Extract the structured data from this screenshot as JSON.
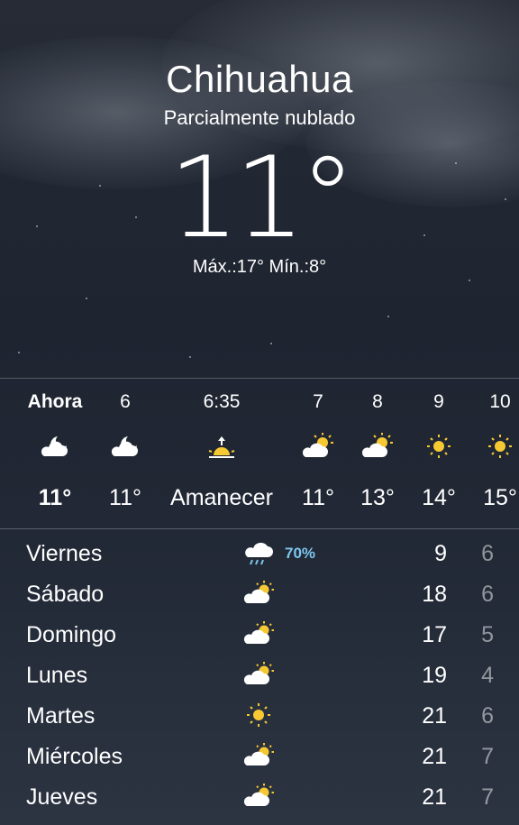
{
  "location": {
    "city": "Chihuahua",
    "condition": "Parcialmente nublado",
    "temperature": "11°",
    "hi_lo": "Máx.:17° Mín.:8°"
  },
  "hourly": [
    {
      "time": "Ahora",
      "icon": "moon-cloud-icon",
      "temp": "11°",
      "bold": true
    },
    {
      "time": "6",
      "icon": "moon-cloud-icon",
      "temp": "11°",
      "bold": false
    },
    {
      "time": "6:35",
      "icon": "sunrise-icon",
      "temp": "Amanecer",
      "bold": false
    },
    {
      "time": "7",
      "icon": "sun-cloud-icon",
      "temp": "11°",
      "bold": false
    },
    {
      "time": "8",
      "icon": "sun-cloud-icon",
      "temp": "13°",
      "bold": false
    },
    {
      "time": "9",
      "icon": "sun-icon",
      "temp": "14°",
      "bold": false
    },
    {
      "time": "10",
      "icon": "sun-icon",
      "temp": "15°",
      "bold": false
    }
  ],
  "daily": [
    {
      "day": "Viernes",
      "icon": "rain-cloud-icon",
      "precip": "70%",
      "high": "9",
      "low": "6"
    },
    {
      "day": "Sábado",
      "icon": "sun-cloud-icon",
      "precip": "",
      "high": "18",
      "low": "6"
    },
    {
      "day": "Domingo",
      "icon": "sun-cloud-icon",
      "precip": "",
      "high": "17",
      "low": "5"
    },
    {
      "day": "Lunes",
      "icon": "sun-cloud-icon",
      "precip": "",
      "high": "19",
      "low": "4"
    },
    {
      "day": "Martes",
      "icon": "sun-icon",
      "precip": "",
      "high": "21",
      "low": "6"
    },
    {
      "day": "Miércoles",
      "icon": "sun-cloud-icon",
      "precip": "",
      "high": "21",
      "low": "7"
    },
    {
      "day": "Jueves",
      "icon": "sun-cloud-icon",
      "precip": "",
      "high": "21",
      "low": "7"
    }
  ],
  "colors": {
    "precip": "#7dc6ef",
    "sun": "#f6c932",
    "cloud": "#ffffff",
    "rain": "#7dc6ef"
  }
}
